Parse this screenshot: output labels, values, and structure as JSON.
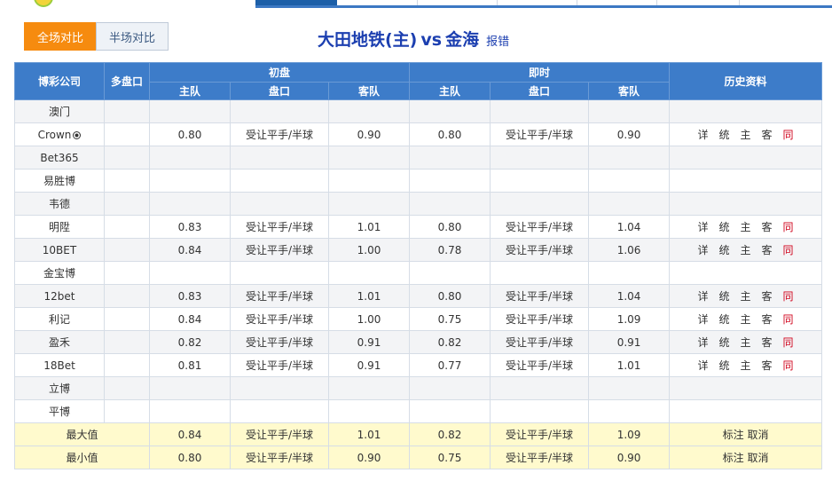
{
  "toggle": {
    "full_label": "全场对比",
    "half_label": "半场对比"
  },
  "match": {
    "home": "大田地铁(主)",
    "vs": "vs",
    "away": "金海",
    "report": "报错"
  },
  "header": {
    "company": "博彩公司",
    "multi": "多盘口",
    "initial": "初盘",
    "live": "即时",
    "history": "历史资料",
    "home": "主队",
    "handicap": "盘口",
    "away": "客队"
  },
  "rows": [
    {
      "company": "澳门",
      "ball": false,
      "ih": "",
      "ip": "",
      "ia": "",
      "lh": "",
      "lp": "",
      "la": "",
      "hist": false
    },
    {
      "company": "Crown",
      "ball": true,
      "ih": "0.80",
      "ip": "受让平手/半球",
      "ia": "0.90",
      "lh": "0.80",
      "lp": "受让平手/半球",
      "la": "0.90",
      "hist": true
    },
    {
      "company": "Bet365",
      "ball": false,
      "ih": "",
      "ip": "",
      "ia": "",
      "lh": "",
      "lp": "",
      "la": "",
      "hist": false
    },
    {
      "company": "易胜博",
      "ball": false,
      "ih": "",
      "ip": "",
      "ia": "",
      "lh": "",
      "lp": "",
      "la": "",
      "hist": false
    },
    {
      "company": "韦德",
      "ball": false,
      "ih": "",
      "ip": "",
      "ia": "",
      "lh": "",
      "lp": "",
      "la": "",
      "hist": false
    },
    {
      "company": "明陞",
      "ball": false,
      "ih": "0.83",
      "ip": "受让平手/半球",
      "ia": "1.01",
      "lh": "0.80",
      "lp": "受让平手/半球",
      "la": "1.04",
      "hist": true
    },
    {
      "company": "10BET",
      "ball": false,
      "ih": "0.84",
      "ip": "受让平手/半球",
      "ia": "1.00",
      "lh": "0.78",
      "lp": "受让平手/半球",
      "la": "1.06",
      "hist": true
    },
    {
      "company": "金宝博",
      "ball": false,
      "ih": "",
      "ip": "",
      "ia": "",
      "lh": "",
      "lp": "",
      "la": "",
      "hist": false
    },
    {
      "company": "12bet",
      "ball": false,
      "ih": "0.83",
      "ip": "受让平手/半球",
      "ia": "1.01",
      "lh": "0.80",
      "lp": "受让平手/半球",
      "la": "1.04",
      "hist": true
    },
    {
      "company": "利记",
      "ball": false,
      "ih": "0.84",
      "ip": "受让平手/半球",
      "ia": "1.00",
      "lh": "0.75",
      "lp": "受让平手/半球",
      "la": "1.09",
      "hist": true
    },
    {
      "company": "盈禾",
      "ball": false,
      "ih": "0.82",
      "ip": "受让平手/半球",
      "ia": "0.91",
      "lh": "0.82",
      "lp": "受让平手/半球",
      "la": "0.91",
      "hist": true
    },
    {
      "company": "18Bet",
      "ball": false,
      "ih": "0.81",
      "ip": "受让平手/半球",
      "ia": "0.91",
      "lh": "0.77",
      "lp": "受让平手/半球",
      "la": "1.01",
      "hist": true
    },
    {
      "company": "立博",
      "ball": false,
      "ih": "",
      "ip": "",
      "ia": "",
      "lh": "",
      "lp": "",
      "la": "",
      "hist": false
    },
    {
      "company": "平博",
      "ball": false,
      "ih": "",
      "ip": "",
      "ia": "",
      "lh": "",
      "lp": "",
      "la": "",
      "hist": false
    }
  ],
  "history_links": {
    "detail": "详",
    "stats": "统",
    "home": "主",
    "away": "客",
    "same": "同"
  },
  "stats": [
    {
      "label": "最大值",
      "ih": "0.84",
      "ip": "受让平手/半球",
      "ia": "1.01",
      "lh": "0.82",
      "lp": "受让平手/半球",
      "la": "1.09",
      "mark": "标注",
      "cancel": "取消"
    },
    {
      "label": "最小值",
      "ih": "0.80",
      "ip": "受让平手/半球",
      "ia": "0.90",
      "lh": "0.75",
      "lp": "受让平手/半球",
      "la": "0.90",
      "mark": "标注",
      "cancel": "取消"
    }
  ],
  "colors": {
    "header_blue": "#3d7cc9",
    "active_orange": "#f68b0f",
    "stat_yellow": "#fffacd",
    "red_link": "#d0021b"
  }
}
